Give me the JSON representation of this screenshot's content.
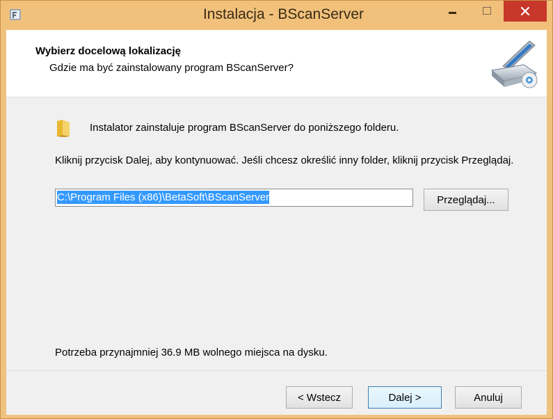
{
  "window": {
    "title": "Instalacja - BScanServer"
  },
  "header": {
    "title": "Wybierz docelową lokalizację",
    "subtitle": "Gdzie ma być zainstalowany program BScanServer?"
  },
  "body": {
    "info_text": "Instalator zainstaluje program BScanServer do poniższego folderu.",
    "instruction_text": "Kliknij przycisk Dalej, aby kontynuować. Jeśli chcesz określić inny folder, kliknij przycisk Przeglądaj.",
    "path_value": "C:\\Program Files (x86)\\BetaSoft\\BScanServer",
    "browse_label": "Przeglądaj...",
    "space_text": "Potrzeba przynajmniej 36.9 MB wolnego miejsca na dysku."
  },
  "footer": {
    "back_label": "< Wstecz",
    "next_label": "Dalej >",
    "cancel_label": "Anuluj"
  },
  "colors": {
    "frame": "#f0c27f",
    "close_button": "#c7372a",
    "selection": "#3399ff"
  },
  "icons": {
    "app": "installer-app-icon",
    "header": "scanner-icon",
    "folder": "folder-icon"
  }
}
